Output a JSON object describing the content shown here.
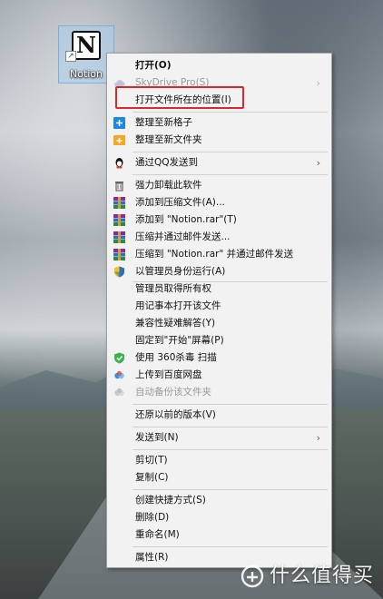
{
  "desktop": {
    "icon_label": "Notion",
    "icon_glyph": "N"
  },
  "menu": {
    "open": "打开(O)",
    "skydrive": "SkyDrive Pro(S)",
    "open_location": "打开文件所在的位置(I)",
    "arrange_new_grid": "整理至新格子",
    "arrange_new_folder": "整理至新文件夹",
    "send_qq": "通过QQ发送到",
    "force_uninstall": "强力卸载此软件",
    "add_to_archive": "添加到压缩文件(A)...",
    "add_to_notion_rar": "添加到 \"Notion.rar\"(T)",
    "compress_email": "压缩并通过邮件发送...",
    "compress_notion_email": "压缩到 \"Notion.rar\" 并通过邮件发送",
    "run_as_admin": "以管理员身份运行(A)",
    "admin_ownership": "管理员取得所有权",
    "open_notepad": "用记事本打开该文件",
    "compat_troubleshoot": "兼容性疑难解答(Y)",
    "pin_start": "固定到\"开始\"屏幕(P)",
    "scan_360": "使用 360杀毒 扫描",
    "upload_baidu": "上传到百度网盘",
    "auto_backup": "自动备份该文件夹",
    "restore_previous": "还原以前的版本(V)",
    "send_to": "发送到(N)",
    "cut": "剪切(T)",
    "copy": "复制(C)",
    "create_shortcut": "创建快捷方式(S)",
    "delete": "删除(D)",
    "rename": "重命名(M)",
    "properties": "属性(R)"
  },
  "watermark": {
    "text": "什么值得买"
  },
  "colors": {
    "highlight_box": "#e0252c",
    "menu_bg": "#f2f2f2"
  }
}
